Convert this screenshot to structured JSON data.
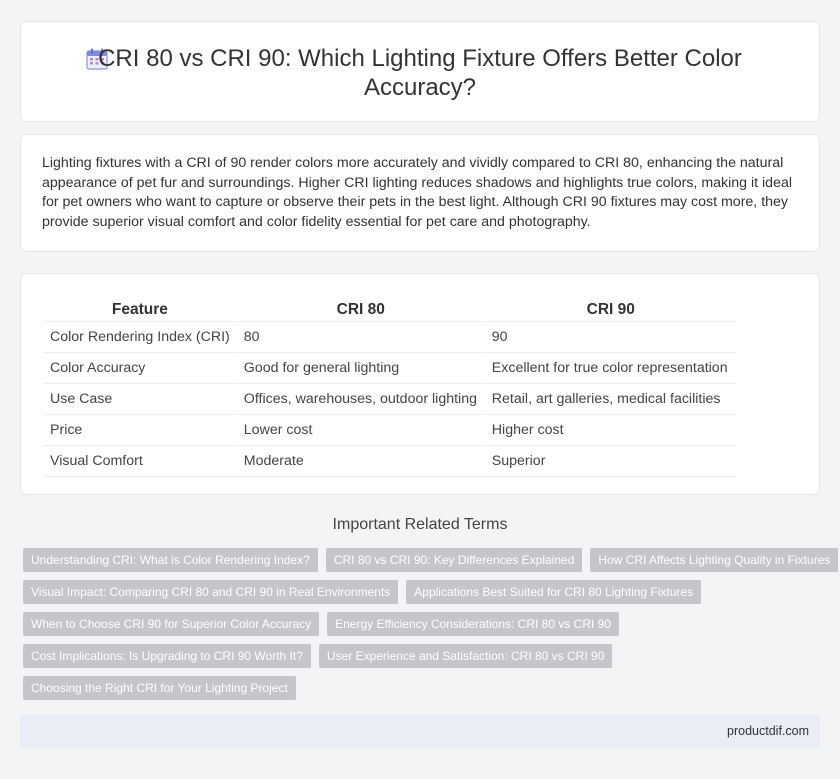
{
  "header": {
    "icon": "calendar-icon",
    "title": "CRI 80 vs CRI 90: Which Lighting Fixture Offers Better Color Accuracy?"
  },
  "intro": {
    "text": "Lighting fixtures with a CRI of 90 render colors more accurately and vividly compared to CRI 80, enhancing the natural appearance of pet fur and surroundings. Higher CRI lighting reduces shadows and highlights true colors, making it ideal for pet owners who want to capture or observe their pets in the best light. Although CRI 90 fixtures may cost more, they provide superior visual comfort and color fidelity essential for pet care and photography."
  },
  "table": {
    "headers": [
      "Feature",
      "CRI 80",
      "CRI 90"
    ],
    "rows": [
      [
        "Color Rendering Index (CRI)",
        "80",
        "90"
      ],
      [
        "Color Accuracy",
        "Good for general lighting",
        "Excellent for true color representation"
      ],
      [
        "Use Case",
        "Offices, warehouses, outdoor lighting",
        "Retail, art galleries, medical facilities"
      ],
      [
        "Price",
        "Lower cost",
        "Higher cost"
      ],
      [
        "Visual Comfort",
        "Moderate",
        "Superior"
      ]
    ]
  },
  "related": {
    "heading": "Important Related Terms",
    "tags": [
      "Understanding CRI: What is Color Rendering Index?",
      "CRI 80 vs CRI 90: Key Differences Explained",
      "How CRI Affects Lighting Quality in Fixtures",
      "Visual Impact: Comparing CRI 80 and CRI 90 in Real Environments",
      "Applications Best Suited for CRI 80 Lighting Fixtures",
      "When to Choose CRI 90 for Superior Color Accuracy",
      "Energy Efficiency Considerations: CRI 80 vs CRI 90",
      "Cost Implications: Is Upgrading to CRI 90 Worth It?",
      "User Experience and Satisfaction: CRI 80 vs CRI 90",
      "Choosing the Right CRI for Your Lighting Project"
    ]
  },
  "footer": {
    "site": "productdif.com"
  },
  "colors": {
    "background": "#f3f4f6",
    "tag": "#c4c6ca",
    "footer": "#e9edf5",
    "icon": "#7b8cde"
  }
}
